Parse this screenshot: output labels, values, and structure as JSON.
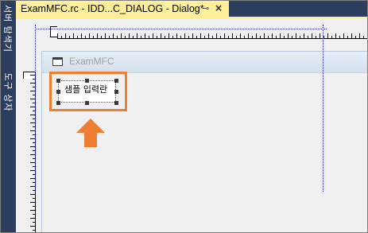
{
  "document_tab": {
    "title": "ExamMFC.rc - IDD...C_DIALOG - Dialog*",
    "pin_glyph": "⊸",
    "close_glyph": "×"
  },
  "side_tabs": [
    {
      "label": "서버 탐색기"
    },
    {
      "label": "도구 상자"
    }
  ],
  "dialog": {
    "title": "ExamMFC"
  },
  "control": {
    "text": "샘플 입력란"
  },
  "colors": {
    "highlight": "#ed7d31",
    "active_tab": "#ffef9b",
    "dock_bg": "#2c3e5e",
    "guide": "#2a2aaa"
  },
  "icons": {
    "pin": "pin-icon",
    "close": "close-icon",
    "dialog_window": "window-icon",
    "pointer_arrow": "up-arrow-icon"
  }
}
